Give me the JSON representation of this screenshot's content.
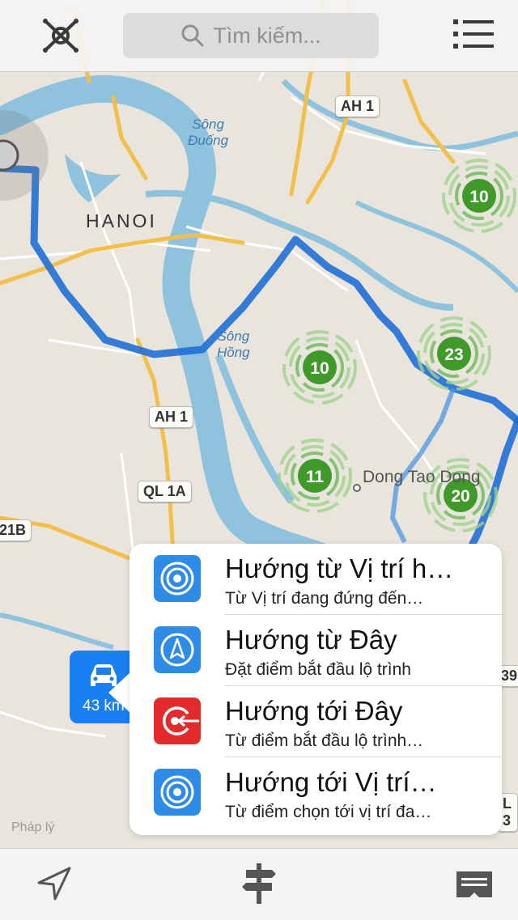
{
  "search": {
    "placeholder": "Tìm kiếm..."
  },
  "map": {
    "road_labels": [
      "AH 1",
      "AH 1",
      "QL 1A",
      "21B",
      "39",
      "L 3"
    ],
    "water_labels": [
      {
        "line1": "Sông",
        "line2": "Đuống"
      },
      {
        "line1": "Sông",
        "line2": "Hồng"
      }
    ],
    "city_label": "HANOI",
    "town_label": "Dong Tao Dong",
    "clusters": [
      {
        "count": "10"
      },
      {
        "count": "10"
      },
      {
        "count": "23"
      },
      {
        "count": "11"
      },
      {
        "count": "20"
      }
    ],
    "legal_text": "Pháp lý",
    "car_distance": "43 km"
  },
  "popup": {
    "items": [
      {
        "title": "Hướng từ Vị trí h…",
        "subtitle": "Từ Vị trí đang đứng đến…",
        "icon": "target-icon",
        "color": "#2f8ce6"
      },
      {
        "title": "Hướng từ Đây",
        "subtitle": "Đặt điểm bắt đầu lộ trình",
        "icon": "compass-arrow-icon",
        "color": "#2f8ce6"
      },
      {
        "title": "Hướng tới Đây",
        "subtitle": "Từ điểm bắt đầu lộ trình…",
        "icon": "target-arrow-icon",
        "color": "#e42b2b"
      },
      {
        "title": "Hướng tới Vị trí…",
        "subtitle": "Từ điểm chọn tới vị trí đa…",
        "icon": "target-icon",
        "color": "#2f8ce6"
      }
    ]
  },
  "colors": {
    "route": "#1f6fd6",
    "water": "#8ec2dd",
    "cluster": "#3f9a2a",
    "major_road": "#f2c04a"
  }
}
